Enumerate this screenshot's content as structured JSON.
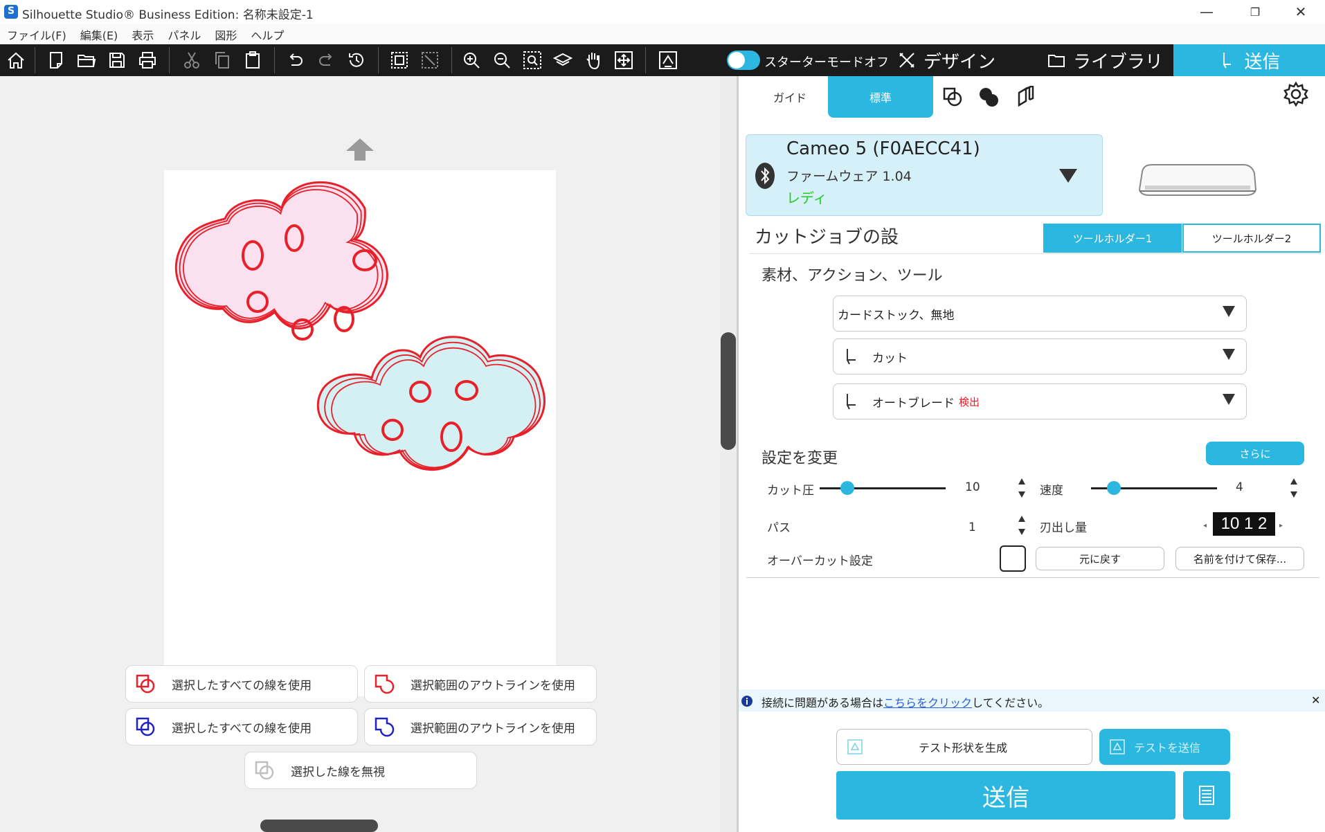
{
  "window": {
    "title": "Silhouette Studio® Business Edition: 名称未設定-1",
    "minimize": "—",
    "restore": "❐",
    "close": "✕"
  },
  "menu": [
    "ファイル(F)",
    "編集(E)",
    "表示",
    "パネル",
    "図形",
    "ヘルプ"
  ],
  "toolbar": {
    "icons": [
      "home-icon",
      "new-page-icon",
      "open-folder-icon",
      "save-icon",
      "print-icon",
      "cut-icon",
      "copy-icon",
      "paste-icon",
      "undo-icon",
      "redo-icon",
      "history-icon",
      "select-group-icon",
      "deselect-icon",
      "zoom-in-icon",
      "zoom-out-icon",
      "zoom-fit-icon",
      "zoom-box-icon",
      "pan-hand-icon",
      "fit-page-icon",
      "trace-icon"
    ],
    "starter_mode": "スターターモードオフ",
    "tabs": {
      "design": "デザイン",
      "library": "ライブラリ",
      "send": "送信"
    }
  },
  "canvas": {
    "cloud_pink_fill": "#fbe0ef",
    "cloud_blue_fill": "#d4f0f3",
    "stroke_color": "#e8202a",
    "buttons": {
      "use_all_red": "選択したすべての線を使用",
      "outline_red": "選択範囲のアウトラインを使用",
      "use_all_blue": "選択したすべての線を使用",
      "outline_blue": "選択範囲のアウトラインを使用",
      "ignore": "選択した線を無視"
    }
  },
  "panel": {
    "subtabs": {
      "guide": "ガイド",
      "standard": "標準"
    },
    "device": {
      "name": "Cameo 5 (F0AECC41)",
      "firmware": "ファームウェア 1.04",
      "status": "レディ"
    },
    "job_title": "カットジョブの設",
    "tool_holders": [
      "ツールホルダー1",
      "ツールホルダー2"
    ],
    "material_section": "素材、アクション、ツール",
    "material": "カードストック、無地",
    "action": "カット",
    "tool_label": "オートブレード",
    "tool_detect": "検出",
    "settings_title": "設定を変更",
    "more": "さらに",
    "force_label": "カット圧",
    "force_value": "10",
    "force_level": 0.22,
    "speed_label": "速度",
    "speed_value": "4",
    "speed_level": 0.18,
    "passes_label": "パス",
    "passes_value": "1",
    "blade_label": "刃出し量",
    "blade_value": "10 1 2",
    "overcut_label": "オーバーカット設定",
    "reset": "元に戻す",
    "save_as": "名前を付けて保存...",
    "info_prefix": "接続に問題がある場合は",
    "info_link": "こちらをクリック",
    "info_suffix": "してください。",
    "info_close": "✕",
    "test_generate": "テスト形状を生成",
    "test_send": "テストを送信",
    "send": "送信"
  },
  "colors": {
    "accent": "#2bb7df",
    "toolbar_bg": "#1b1b1b",
    "status_green": "#22cc22",
    "detect_red": "#e8202a"
  }
}
